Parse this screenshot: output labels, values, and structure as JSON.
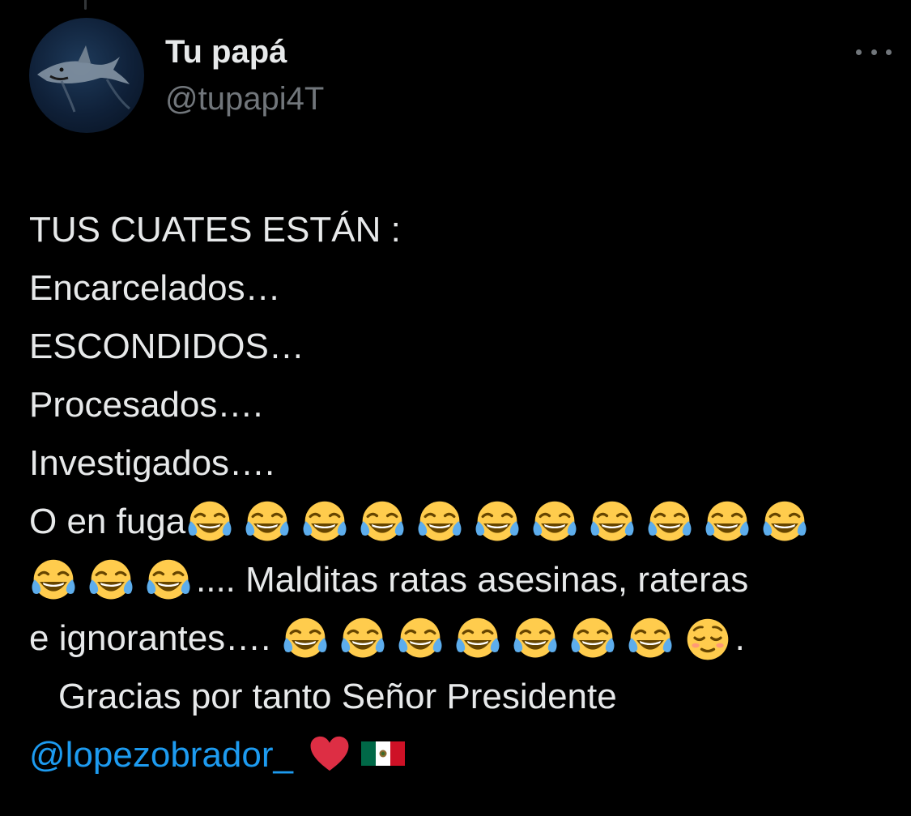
{
  "author": {
    "display_name": "Tu papá",
    "handle": "@tupapi4T",
    "avatar": "shark-avatar"
  },
  "actions": {
    "more_icon": "more-horizontal-icon"
  },
  "tweet": {
    "lines": [
      "TUS CUATES ESTÁN :",
      "Encarcelados…",
      "ESCONDIDOS…",
      "Procesados….",
      "Investigados….",
      "O en fuga",
      ".... Malditas ratas asesinas, rateras",
      "e ignorantes….",
      ".",
      "Gracias por tanto Señor Presidente"
    ],
    "mention": "@lopezobrador_",
    "emoji": {
      "laughing": "face-with-tears-of-joy-icon",
      "relieved": "relieved-face-icon",
      "heart": "red-heart-icon",
      "flag": "mexico-flag-icon"
    }
  },
  "colors": {
    "background": "#000000",
    "text": "#e7e9ea",
    "secondary": "#71767b",
    "link": "#1d9bf0"
  }
}
